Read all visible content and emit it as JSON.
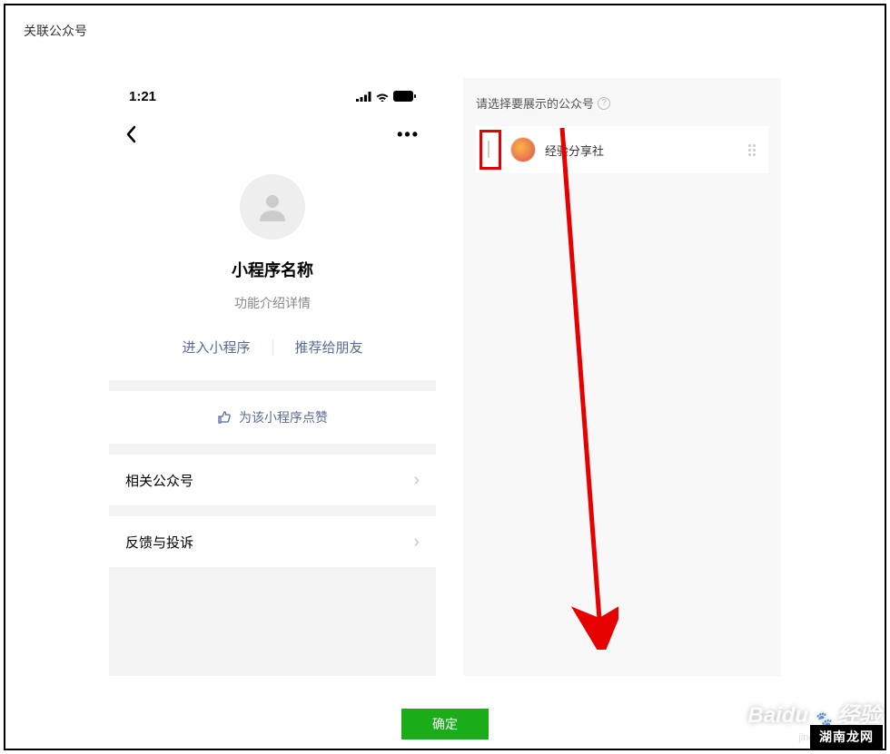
{
  "modal": {
    "title": "关联公众号"
  },
  "phone": {
    "time": "1:21",
    "app_name": "小程序名称",
    "app_desc": "功能介绍详情",
    "action_enter": "进入小程序",
    "action_share": "推荐给朋友",
    "like_label": "为该小程序点赞",
    "row_related": "相关公众号",
    "row_feedback": "反馈与投诉"
  },
  "selector": {
    "title": "请选择要展示的公众号",
    "accounts": [
      {
        "name": "经验分享社"
      }
    ]
  },
  "buttons": {
    "confirm": "确定"
  },
  "watermark": {
    "brand": "Baidu",
    "label": "经验",
    "url": "jingyan.baidu.com",
    "site": "湖南龙网"
  }
}
